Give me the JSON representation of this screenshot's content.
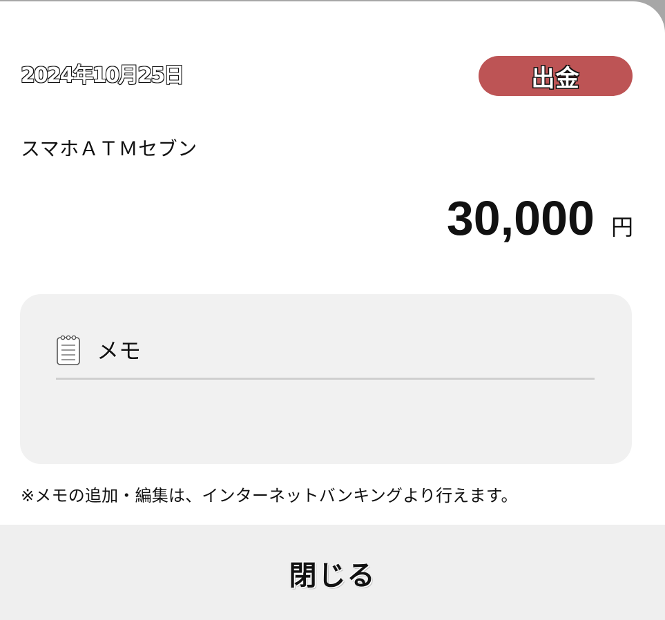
{
  "transaction": {
    "date": "2024年10月25日",
    "type_badge": "出金",
    "merchant": "スマホＡＴＭセブン",
    "amount": "30,000",
    "currency_unit": "円"
  },
  "memo": {
    "icon": "notepad-icon",
    "label": "メモ",
    "value": ""
  },
  "note": "※メモの追加・編集は、インターネットバンキングより行えます。",
  "footer": {
    "close_label": "閉じる"
  },
  "colors": {
    "badge": "#bd5455",
    "memo_bg": "#f1f1f1",
    "footer_bg": "#efefef"
  }
}
